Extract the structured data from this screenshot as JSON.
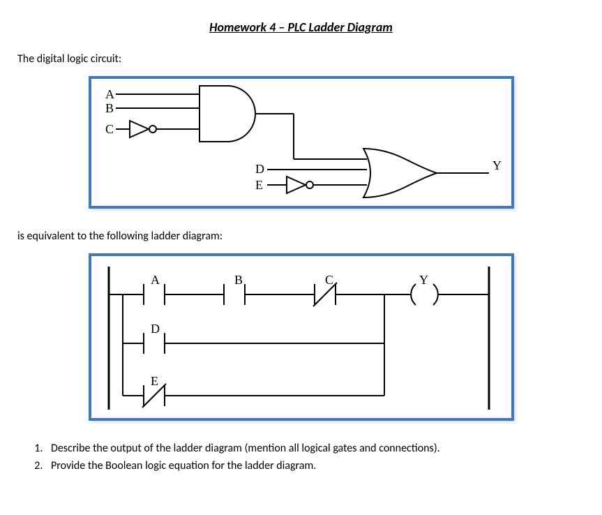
{
  "title": "Homework 4 – PLC Ladder Diagram",
  "intro_text": "The digital logic circuit:",
  "equiv_text": "is equivalent to the following ladder diagram:",
  "logic_labels": {
    "A": "A",
    "B": "B",
    "C": "C",
    "D": "D",
    "E": "E",
    "Y": "Y"
  },
  "ladder_labels": {
    "A": "A",
    "B": "B",
    "C": "C",
    "D": "D",
    "E": "E",
    "Y": "Y"
  },
  "questions": {
    "q1": "Describe the output of the ladder diagram (mention all logical gates and connections).",
    "q2": "Provide the Boolean logic equation for the ladder diagram."
  }
}
